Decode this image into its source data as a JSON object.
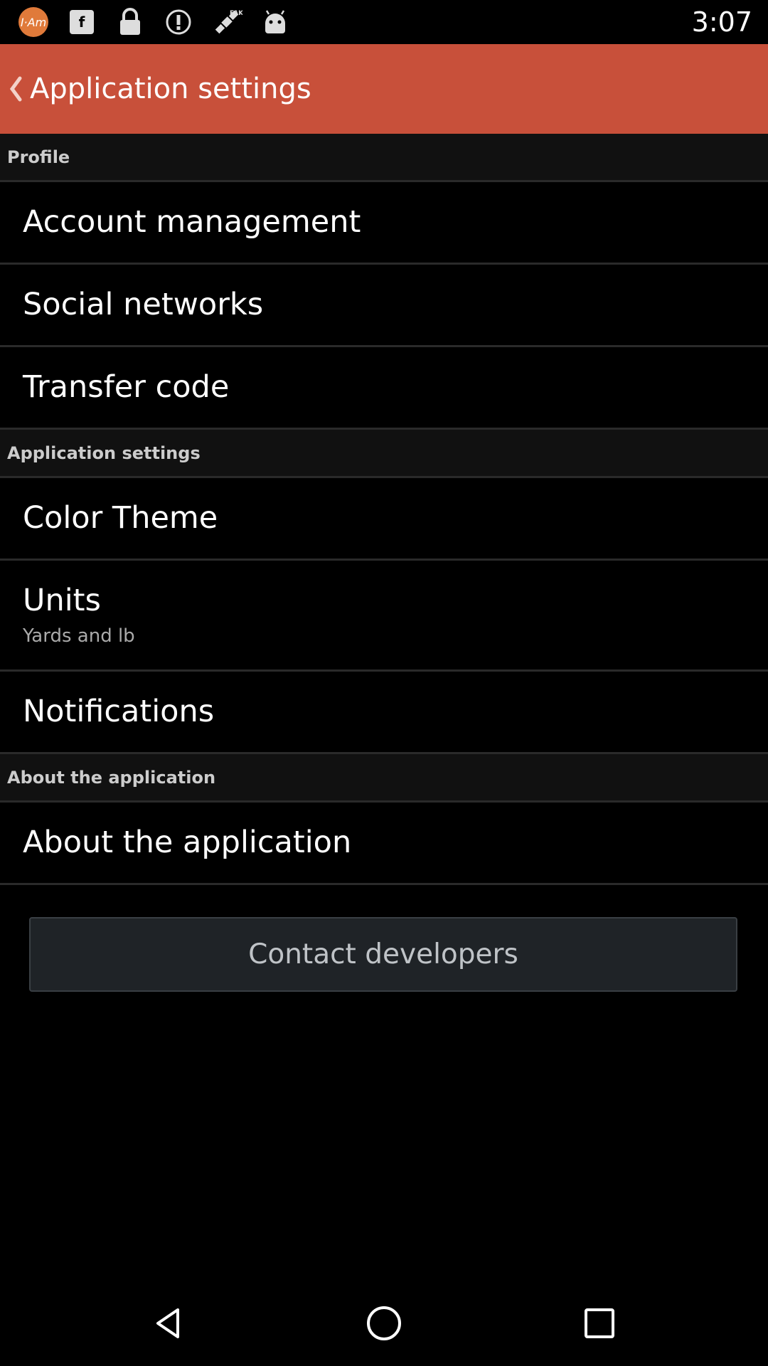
{
  "status_bar": {
    "time": "3:07",
    "icons": [
      "i-am-app-icon",
      "fake-gps-icon",
      "lock-icon",
      "info-icon",
      "satellite-icon",
      "android-icon"
    ]
  },
  "app_bar": {
    "title": "Application settings",
    "back_icon": "chevron-left-icon",
    "color": "#c8503a"
  },
  "sections": {
    "profile": {
      "header": "Profile",
      "items": {
        "account_management": "Account management",
        "social_networks": "Social networks",
        "transfer_code": "Transfer code"
      }
    },
    "application_settings": {
      "header": "Application settings",
      "items": {
        "color_theme": "Color Theme",
        "units": "Units",
        "units_value": "Yards and lb",
        "notifications": "Notifications"
      }
    },
    "about": {
      "header": "About the application",
      "items": {
        "about_application": "About the application"
      }
    }
  },
  "contact_button": "Contact developers",
  "nav_bar": {
    "icons": [
      "back-triangle-icon",
      "home-circle-icon",
      "recents-square-icon"
    ]
  }
}
